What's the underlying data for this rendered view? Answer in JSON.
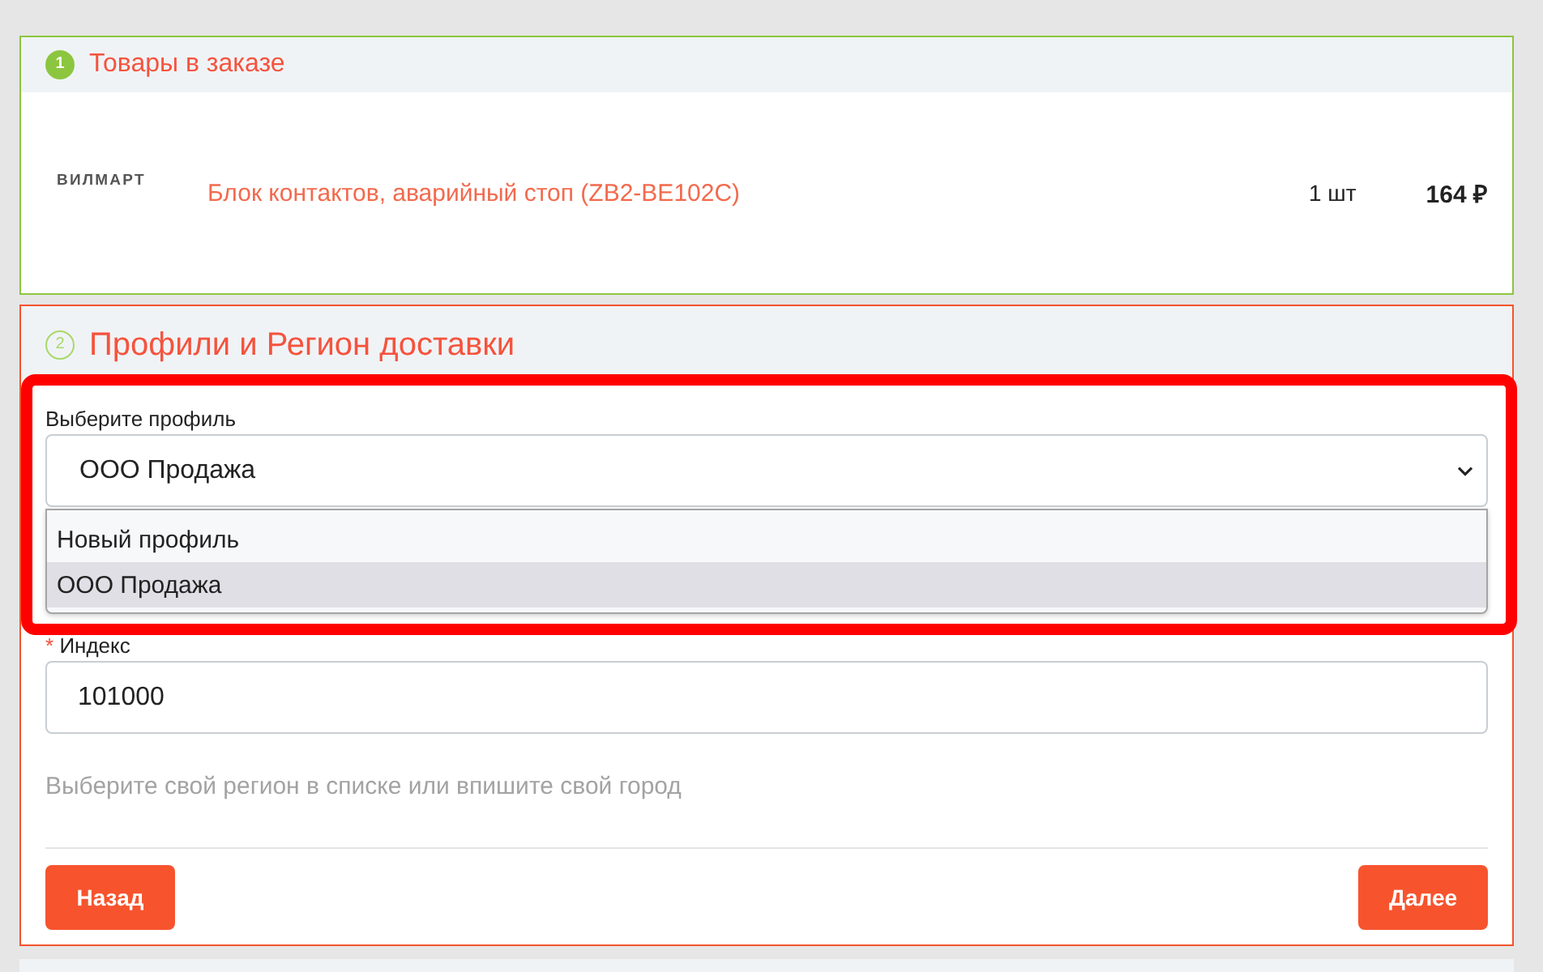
{
  "steps": [
    {
      "number": "1",
      "title": "Товары в заказе",
      "completed": true,
      "items": [
        {
          "brand": "ВИЛМАРТ",
          "name": "Блок контактов, аварийный стоп (ZB2-BE102C)",
          "quantity": "1 шт",
          "price": "164 ₽"
        }
      ]
    },
    {
      "number": "2",
      "title": "Профили и Регион доставки",
      "completed": false,
      "profile": {
        "label": "Выберите профиль",
        "value": "ООО Продажа",
        "expanded": true,
        "highlighted": true,
        "options": [
          {
            "label": "Новый профиль",
            "selected": false
          },
          {
            "label": "ООО Продажа",
            "selected": true
          }
        ]
      },
      "postcode": {
        "required_mark": "*",
        "label": "Индекс",
        "value": "101000"
      },
      "hint": "Выберите свой регион в списке или впишите свой город",
      "buttons": [
        {
          "label": "Назад",
          "kind": "back"
        },
        {
          "label": "Далее",
          "kind": "next"
        }
      ]
    }
  ]
}
